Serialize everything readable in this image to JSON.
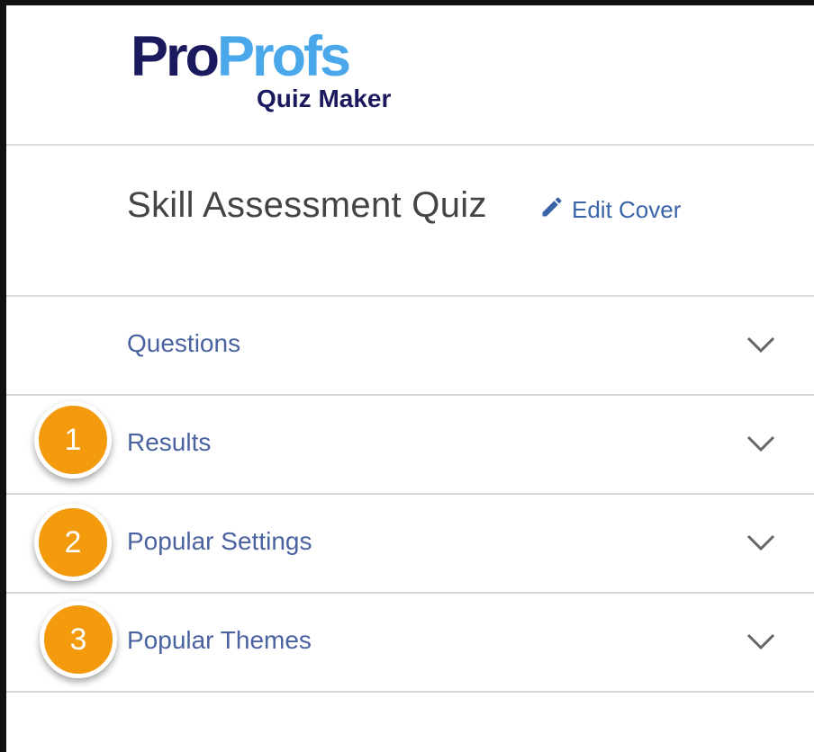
{
  "brand": {
    "logo_part1": "Pro",
    "logo_part2": "Profs",
    "product": "Quiz Maker",
    "colors": {
      "navy": "#1b1a5e",
      "blue": "#4aa8ea"
    }
  },
  "quiz": {
    "title": "Skill Assessment Quiz",
    "edit_cover_label": "Edit Cover",
    "edit_icon": "pencil-icon"
  },
  "sections": [
    {
      "label": "Questions",
      "icon": "chevron-down-icon"
    },
    {
      "label": "Results",
      "icon": "chevron-down-icon",
      "badge": "1"
    },
    {
      "label": "Popular Settings",
      "icon": "chevron-down-icon",
      "badge": "2"
    },
    {
      "label": "Popular Themes",
      "icon": "chevron-down-icon",
      "badge": "3"
    }
  ],
  "colors": {
    "badge": "#f39a0d",
    "link": "#3a64a8",
    "section_text": "#4a62a0"
  }
}
